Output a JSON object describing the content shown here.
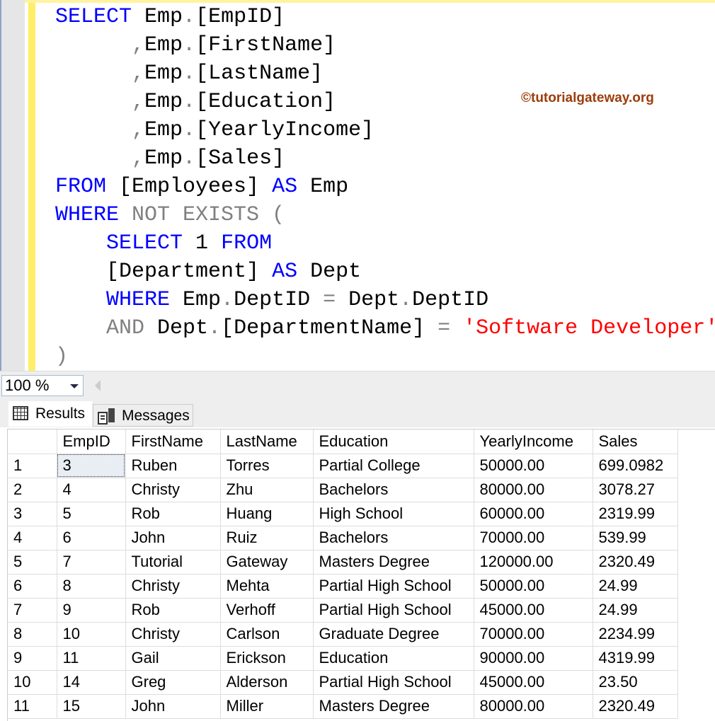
{
  "editor": {
    "lines": [
      [
        [
          "k",
          "SELECT"
        ],
        [
          "",
          " Emp"
        ],
        [
          "g",
          "."
        ],
        [
          "",
          "[EmpID]"
        ]
      ],
      [
        [
          "",
          "      "
        ],
        [
          "g",
          ","
        ],
        [
          "",
          "Emp"
        ],
        [
          "g",
          "."
        ],
        [
          "",
          "[FirstName]"
        ]
      ],
      [
        [
          "",
          "      "
        ],
        [
          "g",
          ","
        ],
        [
          "",
          "Emp"
        ],
        [
          "g",
          "."
        ],
        [
          "",
          "[LastName]"
        ]
      ],
      [
        [
          "",
          "      "
        ],
        [
          "g",
          ","
        ],
        [
          "",
          "Emp"
        ],
        [
          "g",
          "."
        ],
        [
          "",
          "[Education]"
        ]
      ],
      [
        [
          "",
          "      "
        ],
        [
          "g",
          ","
        ],
        [
          "",
          "Emp"
        ],
        [
          "g",
          "."
        ],
        [
          "",
          "[YearlyIncome]"
        ]
      ],
      [
        [
          "",
          "      "
        ],
        [
          "g",
          ","
        ],
        [
          "",
          "Emp"
        ],
        [
          "g",
          "."
        ],
        [
          "",
          "[Sales]"
        ]
      ],
      [
        [
          "k",
          "FROM"
        ],
        [
          "",
          " [Employees] "
        ],
        [
          "k",
          "AS"
        ],
        [
          "",
          " Emp"
        ]
      ],
      [
        [
          "k",
          "WHERE"
        ],
        [
          "g",
          " NOT EXISTS ("
        ]
      ],
      [
        [
          "",
          "    "
        ],
        [
          "k",
          "SELECT"
        ],
        [
          "",
          " 1 "
        ],
        [
          "k",
          "FROM"
        ]
      ],
      [
        [
          "",
          "    [Department] "
        ],
        [
          "k",
          "AS"
        ],
        [
          "",
          " Dept"
        ]
      ],
      [
        [
          "",
          "    "
        ],
        [
          "k",
          "WHERE"
        ],
        [
          "",
          " Emp"
        ],
        [
          "g",
          "."
        ],
        [
          "",
          "DeptID "
        ],
        [
          "g",
          "="
        ],
        [
          "",
          " Dept"
        ],
        [
          "g",
          "."
        ],
        [
          "",
          "DeptID"
        ]
      ],
      [
        [
          "",
          "    "
        ],
        [
          "g",
          "AND"
        ],
        [
          "",
          " Dept"
        ],
        [
          "g",
          "."
        ],
        [
          "",
          "[DepartmentName] "
        ],
        [
          "g",
          "="
        ],
        [
          "s",
          " 'Software Developer'"
        ]
      ],
      [
        [
          "g",
          ")"
        ]
      ]
    ],
    "watermark": "©tutorialgateway.org"
  },
  "zoom": {
    "value": "100 %"
  },
  "tabs": {
    "results": "Results",
    "messages": "Messages"
  },
  "results": {
    "columns": [
      "",
      "EmpID",
      "FirstName",
      "LastName",
      "Education",
      "YearlyIncome",
      "Sales"
    ],
    "rows": [
      [
        "1",
        "3",
        "Ruben",
        "Torres",
        "Partial College",
        "50000.00",
        "699.0982"
      ],
      [
        "2",
        "4",
        "Christy",
        "Zhu",
        "Bachelors",
        "80000.00",
        "3078.27"
      ],
      [
        "3",
        "5",
        "Rob",
        "Huang",
        "High School",
        "60000.00",
        "2319.99"
      ],
      [
        "4",
        "6",
        "John",
        "Ruiz",
        "Bachelors",
        "70000.00",
        "539.99"
      ],
      [
        "5",
        "7",
        "Tutorial",
        "Gateway",
        "Masters Degree",
        "120000.00",
        "2320.49"
      ],
      [
        "6",
        "8",
        "Christy",
        "Mehta",
        "Partial High School",
        "50000.00",
        "24.99"
      ],
      [
        "7",
        "9",
        "Rob",
        "Verhoff",
        "Partial High School",
        "45000.00",
        "24.99"
      ],
      [
        "8",
        "10",
        "Christy",
        "Carlson",
        "Graduate Degree",
        "70000.00",
        "2234.99"
      ],
      [
        "9",
        "11",
        "Gail",
        "Erickson",
        "Education",
        "90000.00",
        "4319.99"
      ],
      [
        "10",
        "14",
        "Greg",
        "Alderson",
        "Partial High School",
        "45000.00",
        "23.50"
      ],
      [
        "11",
        "15",
        "John",
        "Miller",
        "Masters Degree",
        "80000.00",
        "2320.49"
      ]
    ]
  }
}
